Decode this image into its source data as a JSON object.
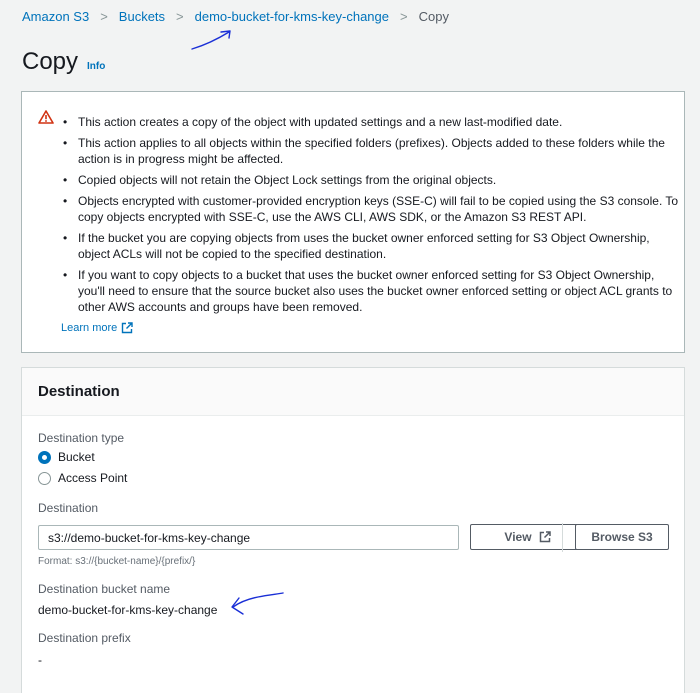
{
  "breadcrumb": {
    "items": [
      "Amazon S3",
      "Buckets",
      "demo-bucket-for-kms-key-change"
    ],
    "current": "Copy",
    "separator": ">"
  },
  "page": {
    "title": "Copy",
    "info_label": "Info"
  },
  "warning": {
    "icon": "warning-icon",
    "bullets": [
      "This action creates a copy of the object with updated settings and a new last-modified date.",
      "This action applies to all objects within the specified folders (prefixes). Objects added to these folders while the action is in progress might be affected.",
      "Copied objects will not retain the Object Lock settings from the original objects.",
      "Objects encrypted with customer-provided encryption keys (SSE-C) will fail to be copied using the S3 console. To copy objects encrypted with SSE-C, use the AWS CLI, AWS SDK, or the Amazon S3 REST API.",
      "If the bucket you are copying objects from uses the bucket owner enforced setting for S3 Object Ownership, object ACLs will not be copied to the specified destination.",
      "If you want to copy objects to a bucket that uses the bucket owner enforced setting for S3 Object Ownership, you'll need to ensure that the source bucket also uses the bucket owner enforced setting or object ACL grants to other AWS accounts and groups have been removed."
    ],
    "learn_more": "Learn more"
  },
  "destination": {
    "heading": "Destination",
    "type_label": "Destination type",
    "options": [
      {
        "label": "Bucket",
        "selected": true
      },
      {
        "label": "Access Point",
        "selected": false
      }
    ],
    "field_label": "Destination",
    "input_value": "s3://demo-bucket-for-kms-key-change",
    "view_button": "View",
    "browse_button": "Browse S3",
    "format_hint": "Format: s3://{bucket-name}/{prefix/}",
    "bucket_name_label": "Destination bucket name",
    "bucket_name_value": "demo-bucket-for-kms-key-change",
    "prefix_label": "Destination prefix",
    "prefix_value": "-"
  },
  "colors": {
    "link": "#0073bb",
    "warning": "#d13212",
    "annotation": "#1a2fd6"
  }
}
